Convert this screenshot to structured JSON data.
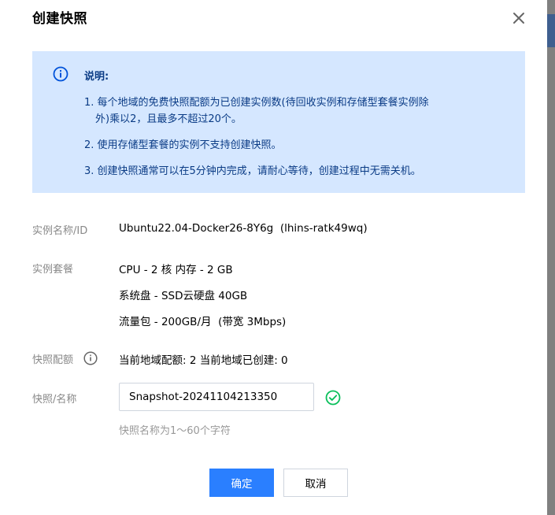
{
  "dialog": {
    "title": "创建快照"
  },
  "notice": {
    "heading": "说明:",
    "items": [
      "1. 每个地域的免费快照配额为已创建实例数(待回收实例和存储型套餐实例除",
      "外)乘以2，且最多不超过20个。",
      "2. 使用存储型套餐的实例不支持创建快照。",
      "3. 创建快照通常可以在5分钟内完成，请耐心等待，创建过程中无需关机。"
    ]
  },
  "instance": {
    "name_label": "实例名称/ID",
    "name_value": "Ubuntu22.04-Docker26-8Y6g  (lhins-ratk49wq)",
    "bundle_label": "实例套餐",
    "bundle_cpu": "CPU - 2 核 内存 - 2 GB",
    "bundle_disk": "系统盘 - SSD云硬盘 40GB",
    "bundle_traffic": "流量包 - 200GB/月  (带宽 3Mbps)"
  },
  "quota": {
    "label": "快照配额",
    "value": "当前地域配额: 2 当前地域已创建: 0"
  },
  "snapshot": {
    "label": "快照/名称",
    "value": "Snapshot-20241104213350",
    "hint": "快照名称为1～60个字符"
  },
  "buttons": {
    "confirm": "确定",
    "cancel": "取消"
  },
  "colors": {
    "primary": "#2a7fff",
    "notice_bg": "#d5e7ff",
    "notice_text": "#0a3b85",
    "success": "#0abf5b"
  },
  "icons": {
    "close": "close-icon",
    "info": "info-icon",
    "help": "question-circle-icon",
    "valid": "check-circle-icon"
  }
}
